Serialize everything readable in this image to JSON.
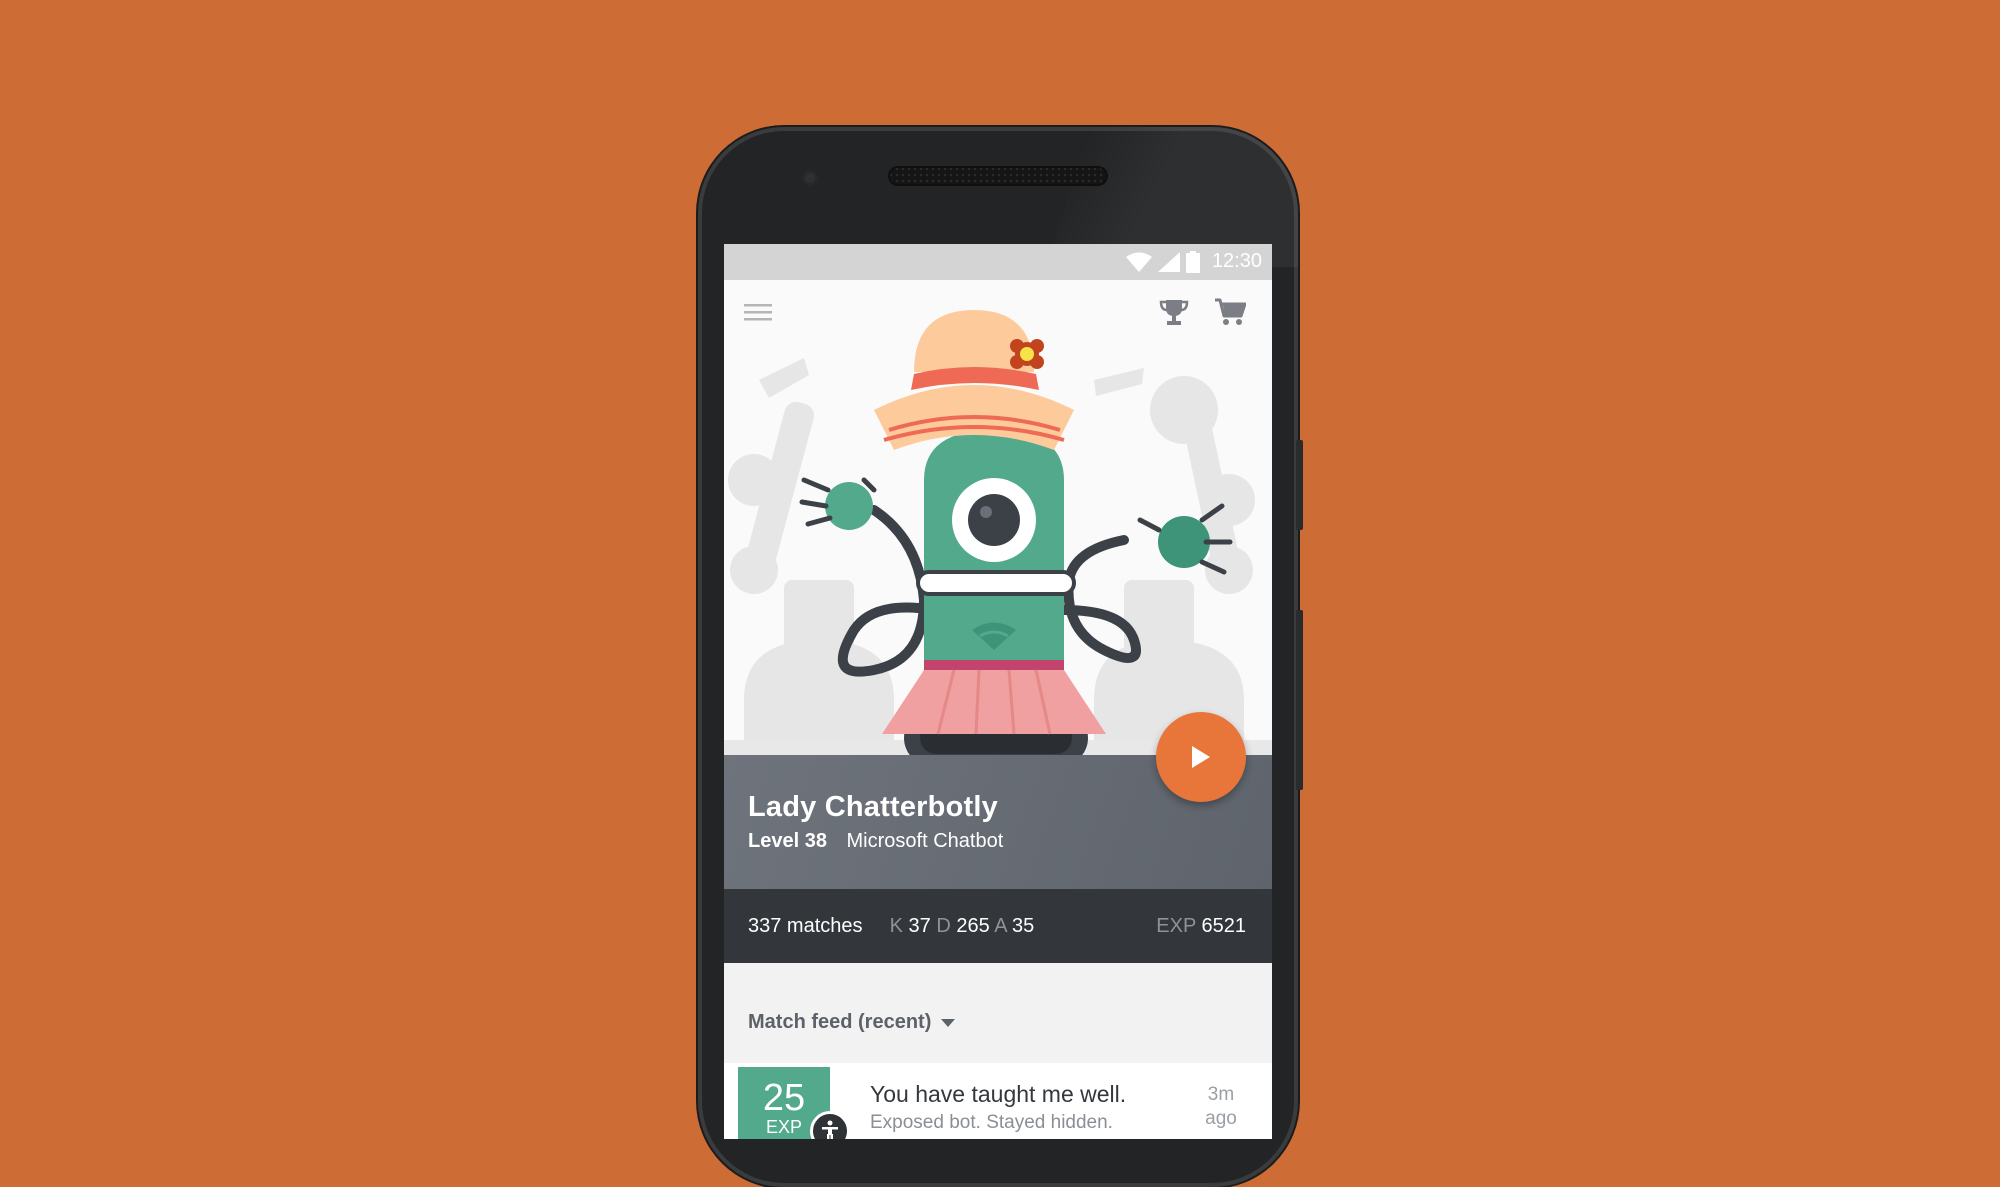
{
  "status_bar": {
    "time": "12:30"
  },
  "app_bar": {
    "menu_icon": "menu-icon",
    "trophy_icon": "trophy-icon",
    "cart_icon": "cart-icon"
  },
  "bot": {
    "name": "Lady Chatterbotly",
    "level": "Level 38",
    "type": "Microsoft Chatbot"
  },
  "stats": {
    "matches": "337 matches",
    "k_label": "K",
    "k_value": "37",
    "d_label": "D",
    "d_value": "265",
    "a_label": "A",
    "a_value": "35",
    "exp_label": "EXP",
    "exp_value": "6521"
  },
  "feed": {
    "header": "Match feed (recent)",
    "items": [
      {
        "exp_value": "25",
        "exp_label": "EXP",
        "title": "You have taught me well.",
        "description": "Exposed bot. Stayed hidden.",
        "time_value": "3m",
        "time_suffix": "ago"
      }
    ]
  },
  "colors": {
    "background": "#cd6c35",
    "accent": "#e8763a",
    "bot_green": "#52a98c",
    "panel": "#6e737c",
    "stats_bar": "#33373c"
  }
}
